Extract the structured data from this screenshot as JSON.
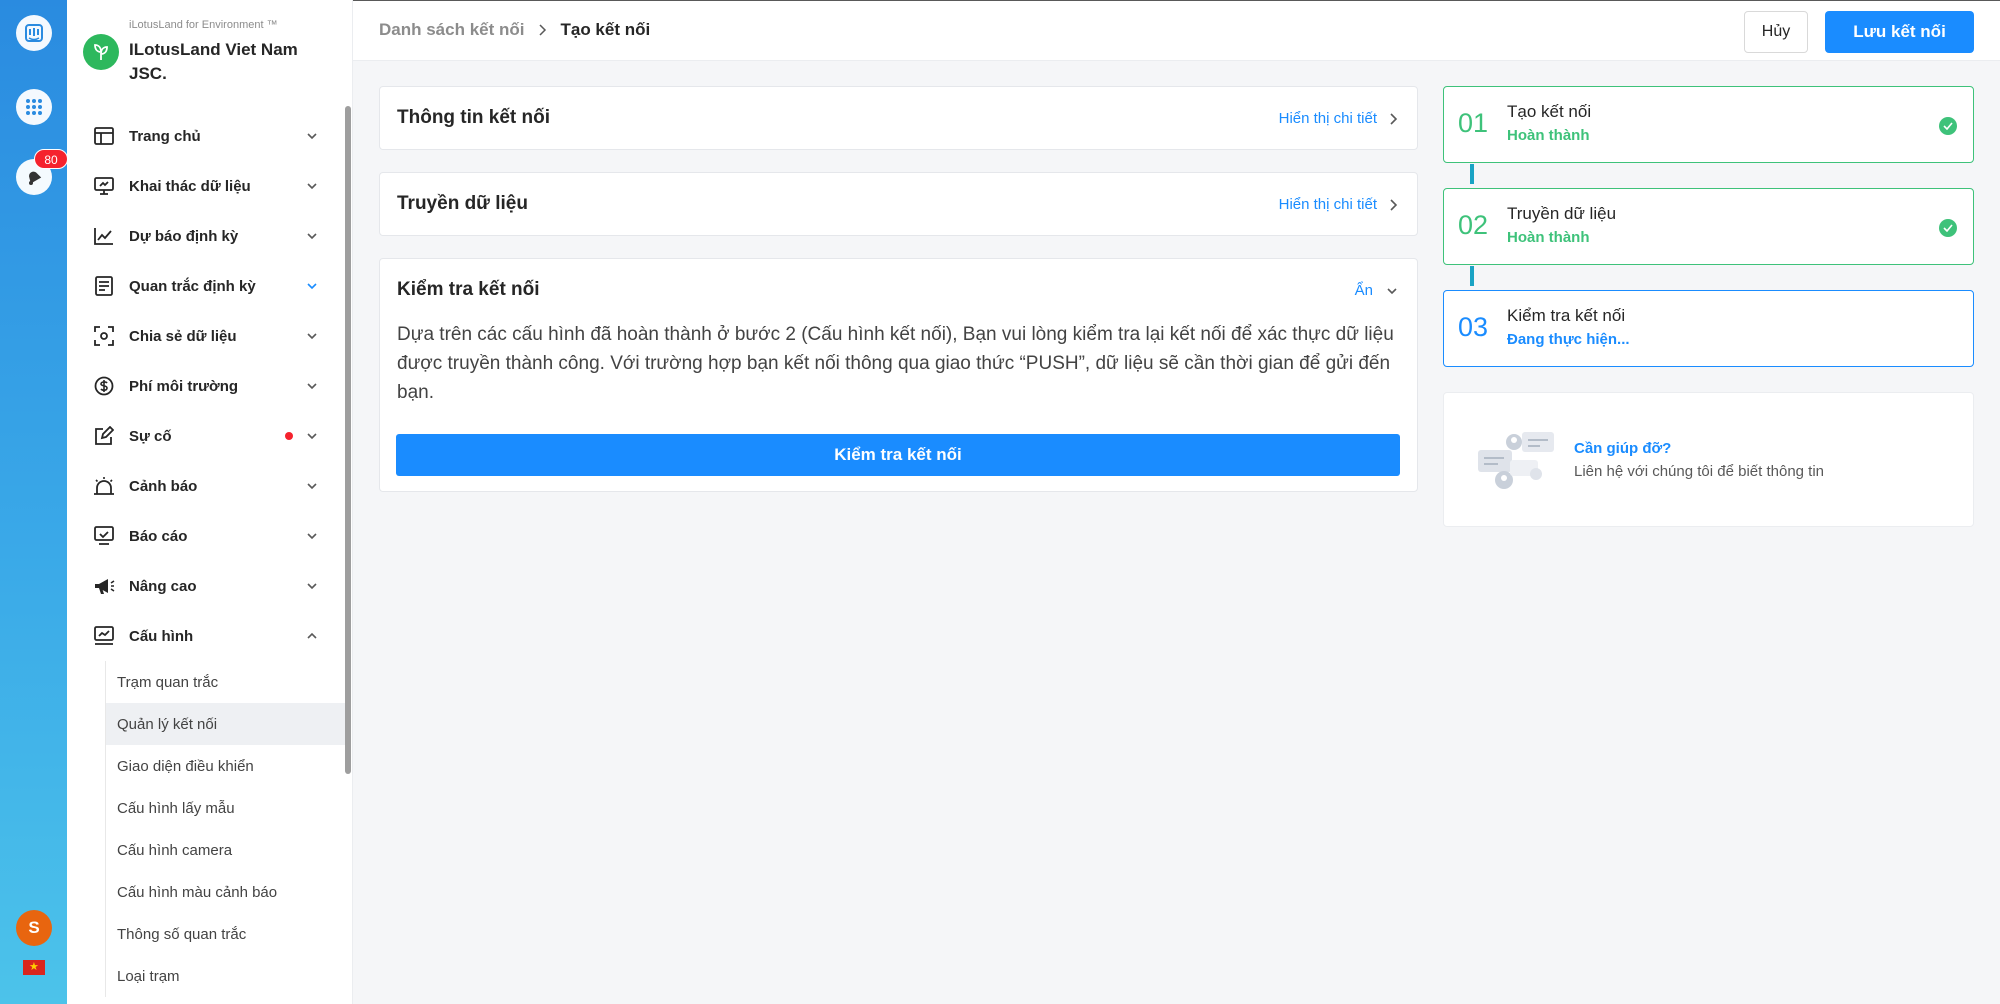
{
  "rail": {
    "badge_count": "80",
    "avatar_letter": "S",
    "flag_star": "★"
  },
  "org": {
    "subtitle": "iLotusLand for Environment ™",
    "name": "ILotusLand Viet Nam JSC."
  },
  "menu": [
    {
      "label": "Trang chủ",
      "icon": "home-icon"
    },
    {
      "label": "Khai thác dữ liệu",
      "icon": "monitor-icon"
    },
    {
      "label": "Dự báo định kỳ",
      "icon": "chart-line-icon"
    },
    {
      "label": "Quan trắc định kỳ",
      "icon": "form-icon"
    },
    {
      "label": "Chia sẻ dữ liệu",
      "icon": "share-icon"
    },
    {
      "label": "Phí môi trường",
      "icon": "dollar-icon"
    },
    {
      "label": "Sự cố",
      "icon": "edit-icon"
    },
    {
      "label": "Cảnh báo",
      "icon": "alarm-icon"
    },
    {
      "label": "Báo cáo",
      "icon": "report-icon"
    },
    {
      "label": "Nâng cao",
      "icon": "megaphone-icon"
    },
    {
      "label": "Cấu hình",
      "icon": "config-icon"
    }
  ],
  "submenu": [
    "Trạm quan trắc",
    "Quản lý kết nối",
    "Giao diện điều khiển",
    "Cấu hình lấy mẫu",
    "Cấu hình camera",
    "Cấu hình màu cảnh báo",
    "Thông số quan trắc",
    "Loại trạm"
  ],
  "header": {
    "breadcrumb_parent": "Danh sách kết nối",
    "breadcrumb_current": "Tạo kết nối",
    "cancel_label": "Hủy",
    "save_label": "Lưu kết nối"
  },
  "sections": {
    "info_title": "Thông tin kết nối",
    "info_link": "Hiển thị chi tiết",
    "transfer_title": "Truyền dữ liệu",
    "transfer_link": "Hiển thị chi tiết",
    "check_title": "Kiểm tra kết nối",
    "check_link": "Ẩn",
    "check_desc": "Dựa trên các cấu hình đã hoàn thành ở bước 2 (Cấu hình kết nối), Bạn vui lòng kiểm tra lại kết nối để xác thực dữ liệu được truyền thành công. Với trường hợp bạn kết nối thông qua giao thức “PUSH”, dữ liệu sẽ cần thời gian để gửi đến bạn.",
    "check_button": "Kiểm tra kết nối"
  },
  "steps": [
    {
      "num": "01",
      "title": "Tạo kết nối",
      "status": "Hoàn thành"
    },
    {
      "num": "02",
      "title": "Truyền dữ liệu",
      "status": "Hoàn thành"
    },
    {
      "num": "03",
      "title": "Kiểm tra kết nối",
      "status": "Đang thực hiện..."
    }
  ],
  "help": {
    "title": "Cần giúp đỡ?",
    "subtitle": "Liên hệ với chúng tôi để biết thông tin"
  },
  "colors": {
    "primary": "#1a8cff",
    "success": "#3ec27a",
    "danger": "#f5222d"
  }
}
